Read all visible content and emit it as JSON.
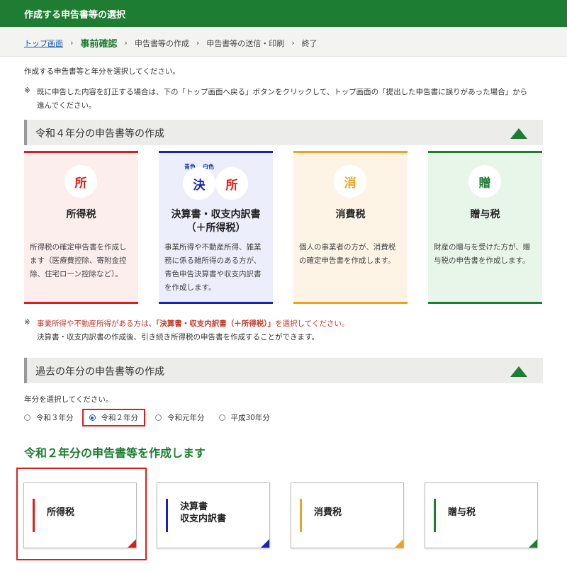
{
  "header": {
    "title": "作成する申告書等の選択"
  },
  "breadcrumb": {
    "top": "トップ画面",
    "current": "事前確認",
    "steps": [
      "申告書等の作成",
      "申告書等の送信・印刷",
      "終了"
    ]
  },
  "intro": "作成する申告書等と年分を選択してください。",
  "note1": {
    "mark": "※",
    "line1": "既に申告した内容を訂正する場合は、下の「トップ画面へ戻る」ボタンをクリックして、トップ画面の「提出した申告書に誤りがあった場合」から",
    "line2": "進んでください。"
  },
  "section_current": {
    "title": "令和４年分の申告書等の作成"
  },
  "cards": [
    {
      "icon": "所",
      "title": "所得税",
      "desc": "所得税の確定申告書を作成します（医療費控除、寄附金控除、住宅ローン控除など）。",
      "color": "#d92020",
      "bg": "#fdeeee"
    },
    {
      "icon": "決",
      "icon2": "所",
      "label_blue": "青色",
      "label_white": "白色",
      "title": "決算書・収支内訳書（＋所得税）",
      "desc": "事業所得や不動産所得、雑業務に係る雑所得のある方が、青色申告決算書や収支内訳書を作成します。",
      "color": "#1a22b8",
      "bg": "#eceefb"
    },
    {
      "icon": "消",
      "title": "消費税",
      "desc": "個人の事業者の方が、消費税の確定申告書を作成します。",
      "color": "#f0a020",
      "bg": "#fdf4e6"
    },
    {
      "icon": "贈",
      "title": "贈与税",
      "desc": "財産の贈与を受けた方が、贈与税の申告書を作成します。",
      "color": "#1e7d32",
      "bg": "#e8f6e9"
    }
  ],
  "note2": {
    "mark": "※",
    "red_pre": "事業所得や不動産所得がある方は、",
    "red_bold": "「決算書・収支内訳書（＋所得税）」",
    "red_post": "を選択してください。",
    "line2": "決算書・収支内訳書の作成後、引き続き所得税の申告書を作成することができます。"
  },
  "section_past": {
    "title": "過去の年分の申告書等の作成"
  },
  "year_prompt": "年分を選択してください。",
  "years": [
    {
      "label": "令和３年分",
      "selected": false
    },
    {
      "label": "令和２年分",
      "selected": true
    },
    {
      "label": "令和元年分",
      "selected": false
    },
    {
      "label": "平成30年分",
      "selected": false
    }
  ],
  "create_title": "令和２年分の申告書等を作成します",
  "buttons": [
    {
      "label": "所得税",
      "color": "#d92020"
    },
    {
      "label1": "決算書",
      "label2": "収支内訳書",
      "color": "#1a22b8"
    },
    {
      "label": "消費税",
      "color": "#f0a020"
    },
    {
      "label": "贈与税",
      "color": "#1e7d32"
    }
  ]
}
